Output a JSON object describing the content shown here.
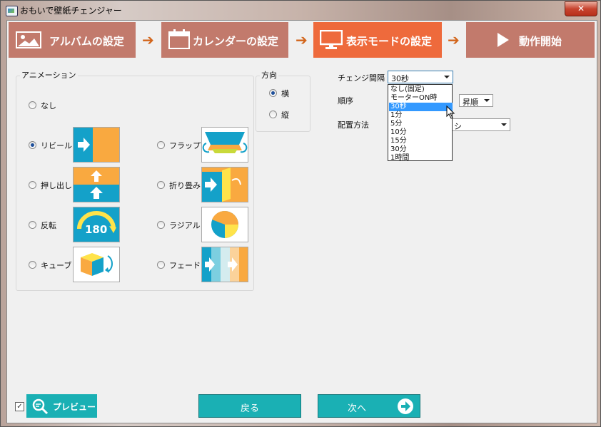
{
  "window": {
    "title": "おもいで壁紙チェンジャー",
    "close_label": "✕"
  },
  "steps": [
    {
      "label": "アルバムの設定",
      "icon": "picture-icon",
      "state": "done",
      "color": "#c27a6c"
    },
    {
      "label": "カレンダーの設定",
      "icon": "calendar-icon",
      "state": "done",
      "color": "#c27a6c"
    },
    {
      "label": "表示モードの設定",
      "icon": "monitor-icon",
      "state": "active",
      "color": "#ee6a3c"
    },
    {
      "label": "動作開始",
      "icon": "play-icon",
      "state": "upcoming",
      "color": "#c27a6c"
    }
  ],
  "step_arrow": "➔",
  "animation": {
    "title": "アニメーション",
    "options": [
      {
        "label": "なし",
        "selected": false,
        "thumb": null
      },
      {
        "label": "リビール",
        "selected": true,
        "thumb": "reveal"
      },
      {
        "label": "フラップ",
        "selected": false,
        "thumb": "flap"
      },
      {
        "label": "押し出し",
        "selected": false,
        "thumb": "push"
      },
      {
        "label": "折り畳み",
        "selected": false,
        "thumb": "fold"
      },
      {
        "label": "反転",
        "selected": false,
        "thumb": "flip180"
      },
      {
        "label": "ラジアル",
        "selected": false,
        "thumb": "radial"
      },
      {
        "label": "キューブ",
        "selected": false,
        "thumb": "cube"
      },
      {
        "label": "フェード",
        "selected": false,
        "thumb": "fade"
      }
    ],
    "flip_text": "180"
  },
  "direction": {
    "title": "方向",
    "options": [
      {
        "label": "横",
        "selected": true
      },
      {
        "label": "縦",
        "selected": false
      }
    ]
  },
  "settings": {
    "interval_label": "チェンジ間隔",
    "interval_value": "30秒",
    "interval_options": [
      "なし(固定)",
      "モーターON時",
      "30秒",
      "1分",
      "5分",
      "10分",
      "15分",
      "30分",
      "1時間"
    ],
    "interval_selected_index": 2,
    "order_label": "順序",
    "order_value": "昇順",
    "layout_label": "配置方法",
    "layout_value_partial": "シ"
  },
  "footer": {
    "preview_checked": true,
    "preview_label": "プレビュー",
    "back_label": "戻る",
    "next_label": "次へ"
  },
  "colors": {
    "teal": "#1ab0b4",
    "orange": "#f9a940",
    "blue": "#14a1c9",
    "yellow": "#ffe34a"
  }
}
